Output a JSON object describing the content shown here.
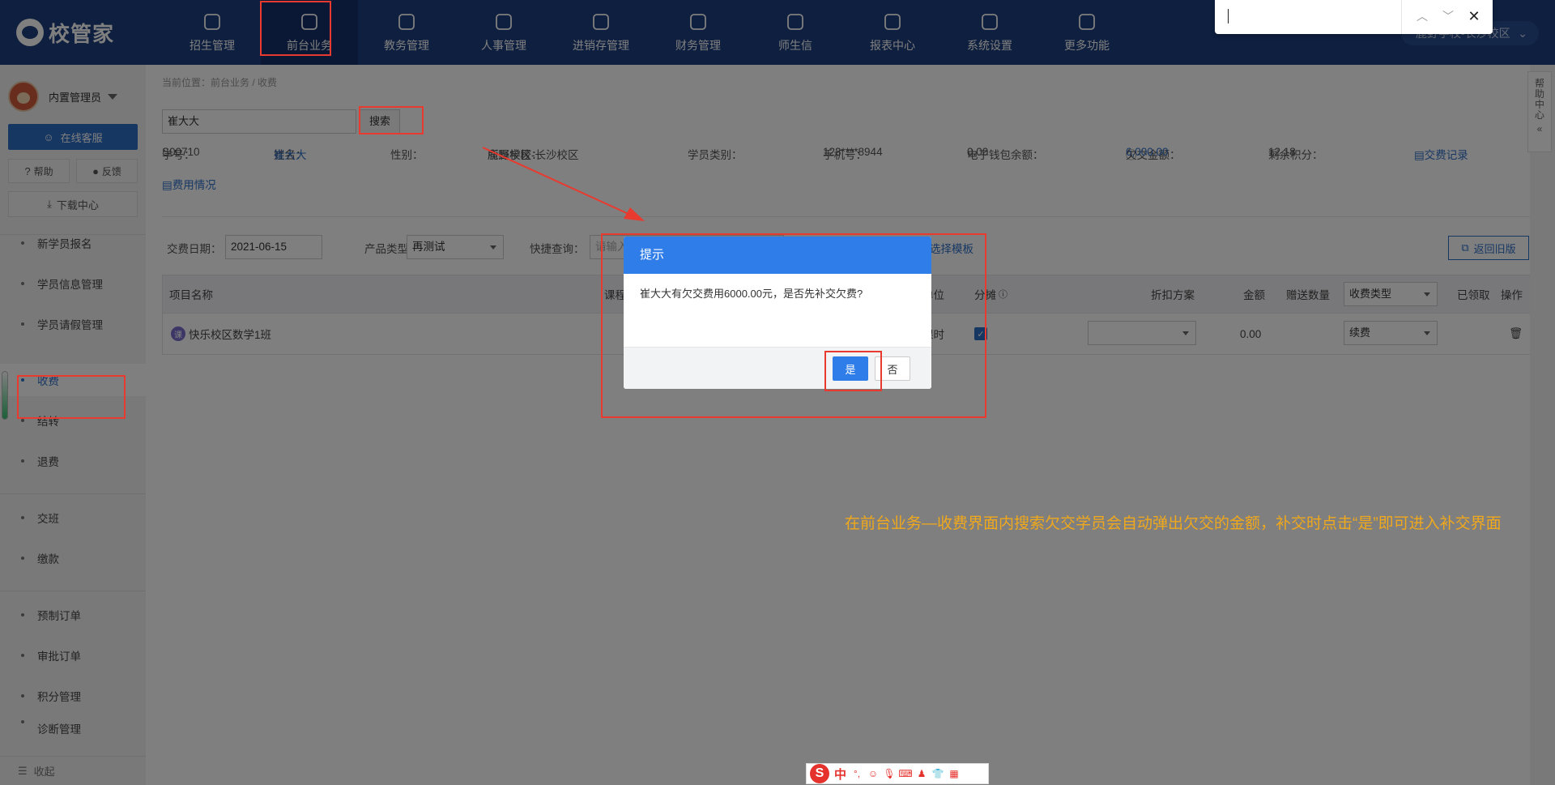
{
  "app": {
    "logo_text": "校管家",
    "campus": "鹿野学校-长沙校区"
  },
  "topnav": [
    {
      "label": "招生管理",
      "icon": "user-plus-icon"
    },
    {
      "label": "前台业务",
      "icon": "front-desk-icon",
      "active": true
    },
    {
      "label": "教务管理",
      "icon": "book-icon"
    },
    {
      "label": "人事管理",
      "icon": "person-icon"
    },
    {
      "label": "进销存管理",
      "icon": "inventory-icon"
    },
    {
      "label": "财务管理",
      "icon": "finance-icon"
    },
    {
      "label": "师生信",
      "icon": "chat-icon"
    },
    {
      "label": "报表中心",
      "icon": "chart-icon"
    },
    {
      "label": "系统设置",
      "icon": "settings-icon"
    },
    {
      "label": "更多功能",
      "icon": "more-icon"
    }
  ],
  "findbar": {
    "value": ""
  },
  "sidebar": {
    "user": "内置管理员",
    "service_label": "在线客服",
    "help_label": "帮助",
    "feedback_label": "反馈",
    "download_label": "下载中心",
    "items": [
      {
        "label": "新学员报名"
      },
      {
        "label": "学员信息管理"
      },
      {
        "label": "学员请假管理"
      },
      {
        "label": "收费",
        "active": true
      },
      {
        "label": "结转"
      },
      {
        "label": "退费"
      },
      {
        "label": "交班"
      },
      {
        "label": "缴款"
      },
      {
        "label": "预制订单"
      },
      {
        "label": "审批订单"
      },
      {
        "label": "积分管理"
      },
      {
        "label": "诊断管理"
      }
    ],
    "collapse_label": "收起"
  },
  "main": {
    "breadcrumb": "当前位置：前台业务 / 收费",
    "search_value": "崔大大",
    "search_btn": "搜索",
    "student": {
      "id_label": "学号：",
      "id": "S00710",
      "name_label": "姓名：",
      "name": "崔大大",
      "gender_label": "性别：",
      "campus_label": "所属校区：",
      "campus": "鹿野学校-长沙校区",
      "type_label": "学员类别：",
      "phone_label": "手机号：",
      "phone": "123****8944",
      "wallet_label": "电子钱包余额：",
      "wallet": "0.00",
      "arrears_label": "欠交金额：",
      "arrears": "6,000.00",
      "points_label": "剩余积分：",
      "points": "12.18",
      "records_link": "交费记录",
      "fee_link": "费用情况"
    },
    "form": {
      "date_label": "交费日期：",
      "date": "2021-06-15",
      "product_label": "产品类型：",
      "product": "再测试",
      "quick_label": "快捷查询：",
      "quick_placeholder": "请输入",
      "template_link": "选择模板",
      "old_btn": "返回旧版"
    },
    "table": {
      "headers": {
        "name": "项目名称",
        "course": "课程",
        "unit": "单位",
        "split": "分摊",
        "discount": "折扣方案",
        "amount": "金额",
        "gift": "赠送数量",
        "fee_type": "收费类型",
        "received": "已领取",
        "action": "操作"
      },
      "rows": [
        {
          "icon_text": "课",
          "name": "快乐校区数学1班",
          "unit": "课时",
          "split_checked": true,
          "discount": "",
          "amount": "0.00",
          "fee_type": "续费"
        }
      ]
    },
    "help_tab": "帮助中心"
  },
  "dialog": {
    "title": "提示",
    "message": "崔大大有欠交费用6000.00元，是否先补交欠费?",
    "yes": "是",
    "no": "否"
  },
  "annotation": "在前台业务—收费界面内搜索欠交学员会自动弹出欠交的金额，补交时点击“是”即可进入补交界面",
  "ime": {
    "lang": "中",
    "logo": "S"
  },
  "colors": {
    "topbar": "#1d3f7e",
    "accent": "#2f6fc6",
    "dialog_header": "#2f7de8",
    "highlight": "#e83a2f",
    "annotation": "#f0a81c"
  }
}
